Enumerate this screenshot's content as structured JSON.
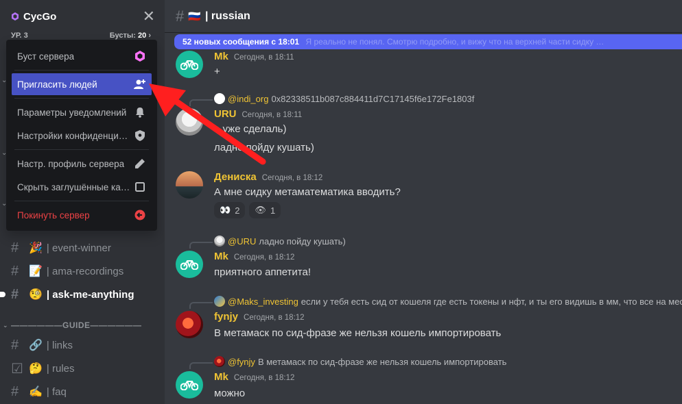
{
  "server": {
    "name": "CycGo",
    "level": "УР. 3",
    "boosts_label": "Бусты:",
    "boosts_count": "20"
  },
  "menu": {
    "items": [
      {
        "label": "Буст сервера",
        "icon": "boost-gem-icon"
      },
      {
        "label": "Пригласить людей",
        "icon": "add-user-icon"
      },
      {
        "label": "Параметры уведомлений",
        "icon": "bell-icon"
      },
      {
        "label": "Настройки конфиденциальности",
        "icon": "shield-icon"
      },
      {
        "label": "Настр. профиль сервера",
        "icon": "pencil-icon"
      },
      {
        "label": "Скрыть заглушённые каналы",
        "icon": "checkbox-icon"
      },
      {
        "label": "Покинуть сервер",
        "icon": "leave-icon"
      }
    ]
  },
  "channels": [
    {
      "emoji": "🎉",
      "label": "| event-winner",
      "unread": false
    },
    {
      "emoji": "📝",
      "label": "| ama-recordings",
      "unread": false
    },
    {
      "emoji": "🧐",
      "label": "| ask-me-anything",
      "unread": true
    },
    {
      "emoji": "🔗",
      "label": "| links",
      "unread": false
    },
    {
      "emoji": "🤔",
      "label": "| rules",
      "unread": false
    },
    {
      "emoji": "✍️",
      "label": "| faq",
      "unread": false
    }
  ],
  "category_guide": "——————GUIDE——————",
  "header": {
    "flag": "🇷🇺",
    "title": "| russian"
  },
  "new_messages_bar": {
    "text": "52 новых сообщения с 18:01",
    "ghost": "Я реально не понял. Смотрю подробно, и вижу что на верхней части сидку …"
  },
  "messages": {
    "m1": {
      "author": "Mk",
      "time": "Сегодня, в 18:11",
      "text": "+"
    },
    "m2": {
      "reply_who": "@indi_org",
      "reply_text": "0x82338511b087c884411d7C17145f6e172Fe1803f",
      "author": "URU",
      "time": "Сегодня, в 18:11",
      "text1": "а уже сделаль)",
      "text2": "ладно пойду кушать)"
    },
    "m3": {
      "author": "Дениска",
      "time": "Сегодня, в 18:12",
      "text": "А мне сидку метаматематика вводить?",
      "reactions": [
        {
          "emoji": "👀",
          "count": "2"
        },
        {
          "emoji": "👁",
          "count": "1"
        }
      ]
    },
    "m4": {
      "reply_who": "@URU",
      "reply_text": "ладно пойду кушать)",
      "author": "Mk",
      "time": "Сегодня, в 18:12",
      "text": "приятного аппетита!"
    },
    "m5": {
      "reply_who": "@Maks_investing",
      "reply_text": "если у тебя есть сид от кошеля где есть токены и нфт, и ты его видишь в мм, что все на мес",
      "author": "fynjy",
      "time": "Сегодня, в 18:12",
      "text": "В метамаск по сид-фразе же нельзя кошель импортировать"
    },
    "m6": {
      "reply_who": "@fynjy",
      "reply_text": "В метамаск по сид-фразе же нельзя кошель импортировать",
      "author": "Mk",
      "time": "Сегодня, в 18:12",
      "text": "можно"
    }
  },
  "colors": {
    "accent": "#5865f2",
    "menu_active": "#4752c4",
    "danger": "#ed4245",
    "author": "#f0c434",
    "annotation_arrow": "#ff1f1f"
  }
}
